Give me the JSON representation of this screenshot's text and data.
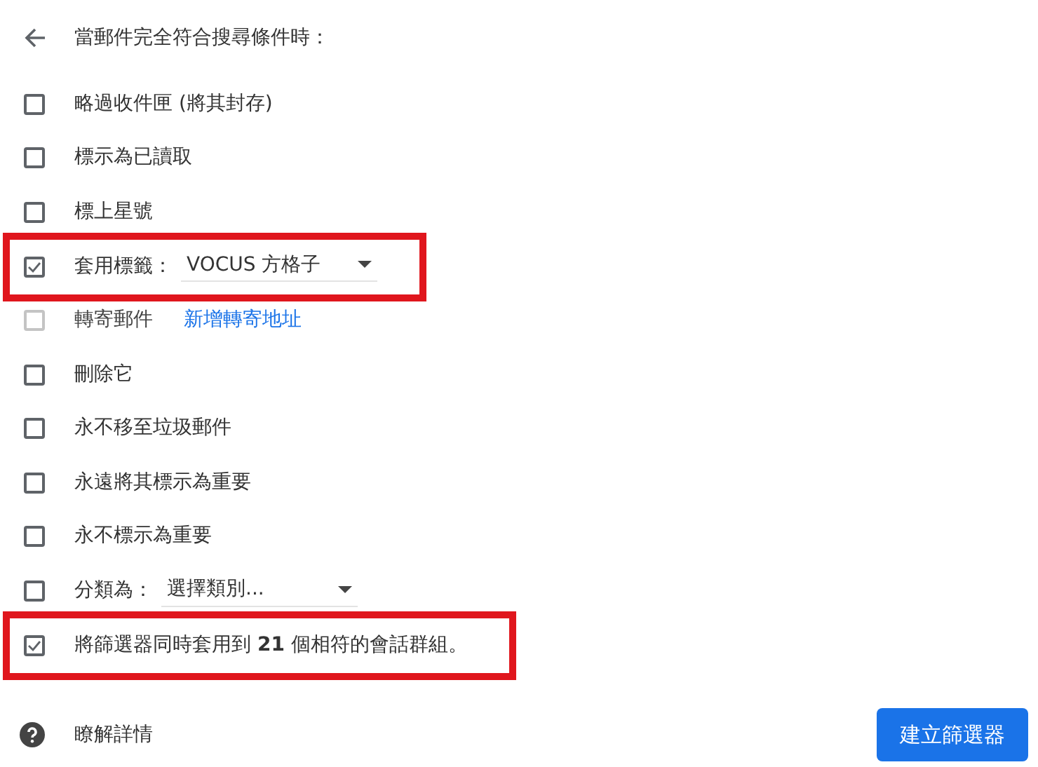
{
  "header": {
    "title": "當郵件完全符合搜尋條件時："
  },
  "options": [
    {
      "kind": "plain",
      "label": "略過收件匣 (將其封存)",
      "checked": false,
      "disabled": false,
      "highlighted": false
    },
    {
      "kind": "plain",
      "label": "標示為已讀取",
      "checked": false,
      "disabled": false,
      "highlighted": false
    },
    {
      "kind": "plain",
      "label": "標上星號",
      "checked": false,
      "disabled": false,
      "highlighted": false
    },
    {
      "kind": "dropdown",
      "label": "套用標籤：",
      "value": "VOCUS 方格子",
      "checked": true,
      "disabled": false,
      "highlighted": true
    },
    {
      "kind": "link",
      "label": "轉寄郵件",
      "link": "新增轉寄地址",
      "checked": false,
      "disabled": true,
      "highlighted": false
    },
    {
      "kind": "plain",
      "label": "刪除它",
      "checked": false,
      "disabled": false,
      "highlighted": false
    },
    {
      "kind": "plain",
      "label": "永不移至垃圾郵件",
      "checked": false,
      "disabled": false,
      "highlighted": false
    },
    {
      "kind": "plain",
      "label": "永遠將其標示為重要",
      "checked": false,
      "disabled": false,
      "highlighted": false
    },
    {
      "kind": "plain",
      "label": "永不標示為重要",
      "checked": false,
      "disabled": false,
      "highlighted": false
    },
    {
      "kind": "dropdown",
      "label": "分類為：",
      "value": "選擇類別...",
      "checked": false,
      "disabled": false,
      "highlighted": false
    },
    {
      "kind": "plain",
      "label": "將篩選器同時套用到 **21** 個相符的會話群組。",
      "checked": true,
      "disabled": false,
      "highlighted": true
    }
  ],
  "footer": {
    "help": "瞭解詳情",
    "button": "建立篩選器"
  }
}
